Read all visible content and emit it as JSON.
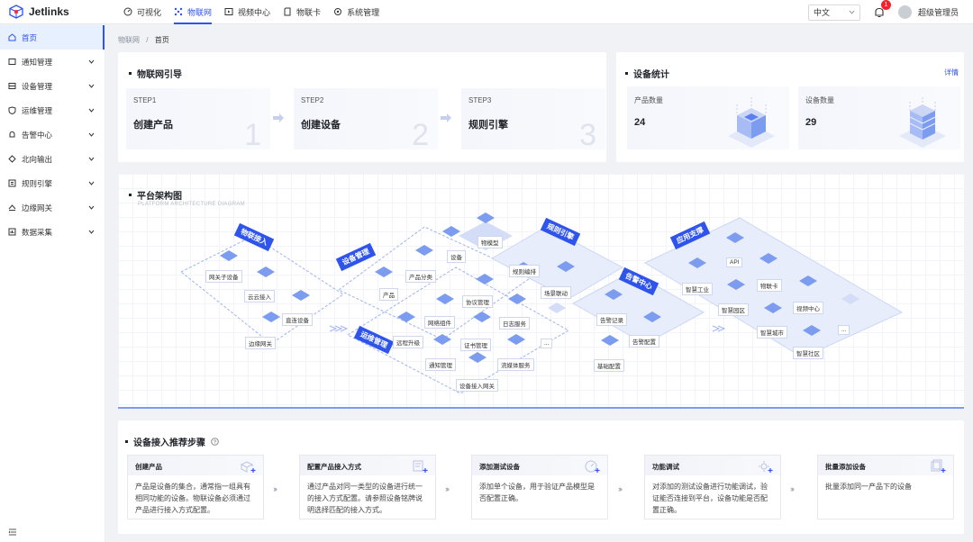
{
  "app": {
    "name": "Jetlinks"
  },
  "topnav": [
    {
      "label": "可视化",
      "icon": "dashboard-icon",
      "active": false
    },
    {
      "label": "物联网",
      "icon": "iot-icon",
      "active": true
    },
    {
      "label": "视频中心",
      "icon": "video-icon",
      "active": false
    },
    {
      "label": "物联卡",
      "icon": "sim-card-icon",
      "active": false
    },
    {
      "label": "系统管理",
      "icon": "settings-icon",
      "active": false
    }
  ],
  "header": {
    "language": "中文",
    "notification_count": "1",
    "username": "超级管理员"
  },
  "sidebar": {
    "items": [
      {
        "label": "首页",
        "icon": "home-icon",
        "active": true
      },
      {
        "label": "通知管理",
        "icon": "notice-icon"
      },
      {
        "label": "设备管理",
        "icon": "device-icon"
      },
      {
        "label": "运维管理",
        "icon": "shield-icon"
      },
      {
        "label": "告警中心",
        "icon": "alarm-icon"
      },
      {
        "label": "北向输出",
        "icon": "output-icon"
      },
      {
        "label": "规则引擎",
        "icon": "rule-icon"
      },
      {
        "label": "边缘网关",
        "icon": "gateway-icon"
      },
      {
        "label": "数据采集",
        "icon": "collect-icon"
      }
    ]
  },
  "breadcrumb": {
    "root": "物联网",
    "sep": "/",
    "current": "首页"
  },
  "guide": {
    "title": "物联网引导",
    "steps": [
      {
        "label": "STEP1",
        "name": "创建产品",
        "num": "1"
      },
      {
        "label": "STEP2",
        "name": "创建设备",
        "num": "2"
      },
      {
        "label": "STEP3",
        "name": "规则引擎",
        "num": "3"
      }
    ]
  },
  "stats": {
    "title": "设备统计",
    "detail": "详情",
    "items": [
      {
        "label": "产品数量",
        "value": "24"
      },
      {
        "label": "设备数量",
        "value": "29"
      }
    ]
  },
  "arch": {
    "title": "平台架构图",
    "subtitle": "PLATFORM ARCHITECTURE DIAGRAM",
    "banners": [
      "物联接入",
      "设备管理",
      "规则引擎",
      "告警中心",
      "应用支撑",
      "运维管理"
    ],
    "tags": [
      "网关子设备",
      "云云接入",
      "直连设备",
      "边缘网关",
      "产品",
      "产品分类",
      "设备",
      "物模型",
      "规则编排",
      "场景联动",
      "协议管理",
      "网络组件",
      "日志服务",
      "远程升级",
      "证书管理",
      "通知管理",
      "流媒体服务",
      "设备接入网关",
      "...",
      "告警记录",
      "告警配置",
      "基础配置",
      "API",
      "智慧工业",
      "物联卡",
      "智慧园区",
      "视频中心",
      "智慧城市",
      "智慧社区",
      "..."
    ]
  },
  "rec": {
    "title": "设备接入推荐步骤",
    "steps": [
      {
        "title": "创建产品",
        "desc": "产品是设备的集合，通常指一组具有相同功能的设备。物联设备必须通过产品进行接入方式配置。"
      },
      {
        "title": "配置产品接入方式",
        "desc": "通过产品对同一类型的设备进行统一的接入方式配置。请参照设备铭牌说明选择匹配的接入方式。"
      },
      {
        "title": "添加测试设备",
        "desc": "添加单个设备，用于验证产品模型是否配置正确。"
      },
      {
        "title": "功能调试",
        "desc": "对添加的测试设备进行功能调试，验证能否连接到平台，设备功能是否配置正确。"
      },
      {
        "title": "批量添加设备",
        "desc": "批量添加同一产品下的设备"
      }
    ]
  },
  "colors": {
    "accent": "#2f54eb",
    "alert": "#f5222d"
  }
}
